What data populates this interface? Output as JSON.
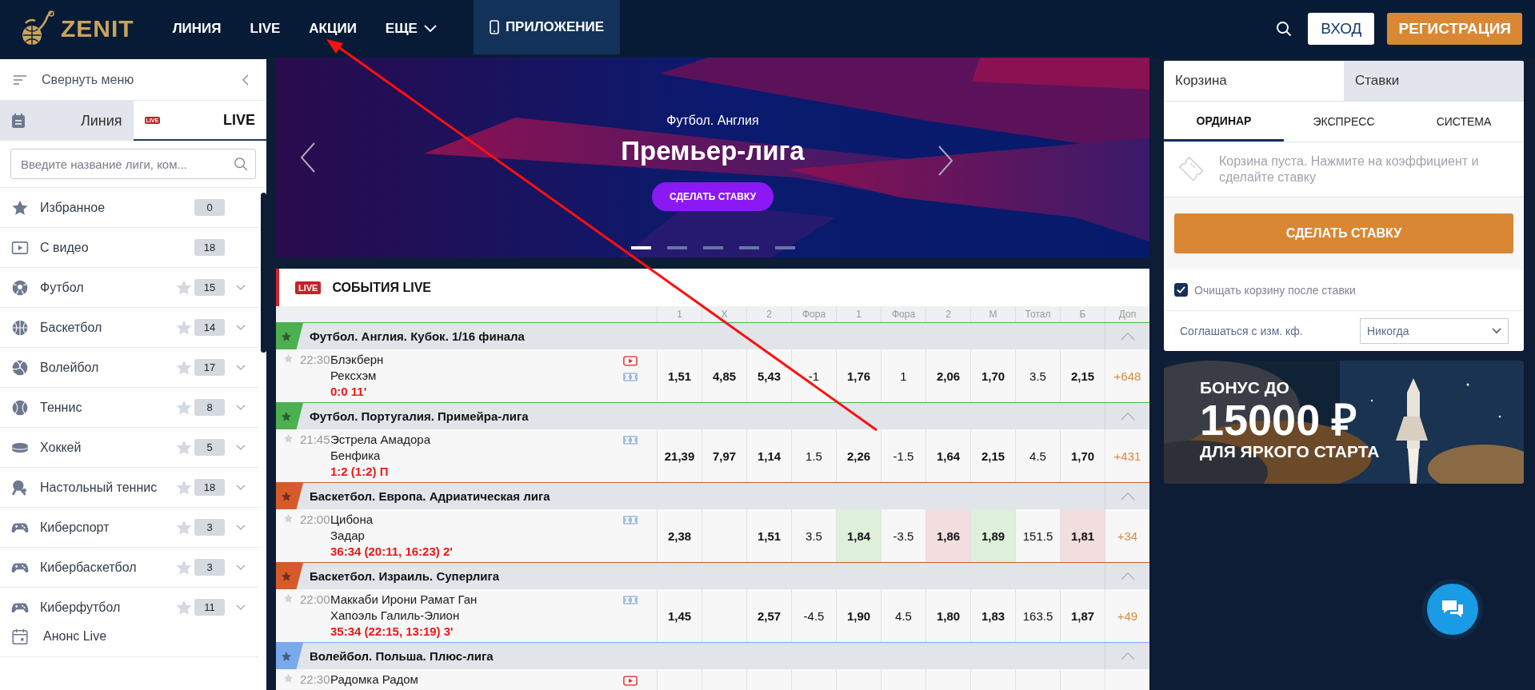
{
  "header": {
    "logo": "ZENIT",
    "nav": [
      {
        "label": "ЛИНИЯ",
        "kind": "link"
      },
      {
        "label": "LIVE",
        "kind": "link"
      },
      {
        "label": "АКЦИИ",
        "kind": "link"
      },
      {
        "label": "ЕЩЕ",
        "kind": "dropdown"
      },
      {
        "label": "ПРИЛОЖЕНИЕ",
        "kind": "app"
      }
    ],
    "login": "ВХОД",
    "register": "РЕГИСТРАЦИЯ"
  },
  "sidebar": {
    "collapse": "Свернуть меню",
    "tabs": [
      {
        "label": "Линия",
        "kind": "line",
        "selected": false
      },
      {
        "label": "LIVE",
        "kind": "live",
        "badge": "LIVE",
        "selected": true
      }
    ],
    "search": {
      "placeholder": "Введите название лиги, ком..."
    },
    "items": [
      {
        "label": "Избранное",
        "kind": "favorites",
        "count": "0"
      },
      {
        "label": "С видео",
        "kind": "video",
        "count": "18"
      },
      {
        "label": "Футбол",
        "kind": "football",
        "count": "15"
      },
      {
        "label": "Баскетбол",
        "kind": "basketball",
        "count": "14"
      },
      {
        "label": "Волейбол",
        "kind": "volleyball",
        "count": "17"
      },
      {
        "label": "Теннис",
        "kind": "tennis",
        "count": "8"
      },
      {
        "label": "Хоккей",
        "kind": "hockey",
        "count": "5"
      },
      {
        "label": "Настольный теннис",
        "kind": "table-tennis",
        "count": "18"
      },
      {
        "label": "Киберспорт",
        "kind": "esports",
        "count": "3"
      },
      {
        "label": "Кибербаскетбол",
        "kind": "esports",
        "count": "3"
      },
      {
        "label": "Киберфутбол",
        "kind": "esports",
        "count": "11"
      }
    ],
    "footer": "Анонс Live"
  },
  "banner": {
    "kicker": "Футбол. Англия",
    "title": "Премьер-лига",
    "button": "СДЕЛАТЬ СТАВКУ",
    "slides": [
      {
        "selected": true
      },
      {
        "selected": false
      },
      {
        "selected": false
      },
      {
        "selected": false
      },
      {
        "selected": false
      }
    ]
  },
  "events": {
    "badge": "LIVE",
    "title": "СОБЫТИЯ LIVE",
    "columns": [
      {
        "label": "1",
        "kind": "odd"
      },
      {
        "label": "X",
        "kind": "odd"
      },
      {
        "label": "2",
        "kind": "odd"
      },
      {
        "label": "Фора",
        "kind": "param"
      },
      {
        "label": "1",
        "kind": "odd"
      },
      {
        "label": "Фора",
        "kind": "param"
      },
      {
        "label": "2",
        "kind": "odd"
      },
      {
        "label": "М",
        "kind": "odd"
      },
      {
        "label": "Тотал",
        "kind": "param"
      },
      {
        "label": "Б",
        "kind": "odd"
      },
      {
        "label": "Доп",
        "kind": "more"
      }
    ],
    "groups": [
      {
        "title": "Футбол. Англия. Кубок. 1/16 финала",
        "color": "#4caf50",
        "events": [
          {
            "time": "22:30",
            "teams": [
              "Блэкберн",
              "Рексхэм"
            ],
            "score": "0:0 11'",
            "video": true,
            "stats": true,
            "odds": [
              {
                "value": "1,51",
                "kind": "plain"
              },
              {
                "value": "4,85",
                "kind": "plain"
              },
              {
                "value": "5,43",
                "kind": "plain"
              },
              {
                "value": "-1",
                "kind": "plain"
              },
              {
                "value": "1,76",
                "kind": "plain"
              },
              {
                "value": "1",
                "kind": "plain"
              },
              {
                "value": "2,06",
                "kind": "plain"
              },
              {
                "value": "1,70",
                "kind": "plain"
              },
              {
                "value": "3.5",
                "kind": "plain"
              },
              {
                "value": "2,15",
                "kind": "plain"
              },
              {
                "value": "+648",
                "kind": "plain"
              }
            ]
          }
        ]
      },
      {
        "title": "Футбол. Португалия. Примейра-лига",
        "color": "#4caf50",
        "events": [
          {
            "time": "21:45",
            "teams": [
              "Эстрела Амадора",
              "Бенфика"
            ],
            "score": "1:2 (1:2) П",
            "video": false,
            "stats": true,
            "odds": [
              {
                "value": "21,39",
                "kind": "plain"
              },
              {
                "value": "7,97",
                "kind": "plain"
              },
              {
                "value": "1,14",
                "kind": "plain"
              },
              {
                "value": "1.5",
                "kind": "plain"
              },
              {
                "value": "2,26",
                "kind": "plain"
              },
              {
                "value": "-1.5",
                "kind": "plain"
              },
              {
                "value": "1,64",
                "kind": "plain"
              },
              {
                "value": "2,15",
                "kind": "plain"
              },
              {
                "value": "4.5",
                "kind": "plain"
              },
              {
                "value": "1,70",
                "kind": "plain"
              },
              {
                "value": "+431",
                "kind": "plain"
              }
            ]
          }
        ]
      },
      {
        "title": "Баскетбол. Европа. Адриатическая лига",
        "color": "#d65a2b",
        "events": [
          {
            "time": "22:00",
            "teams": [
              "Цибона",
              "Задар"
            ],
            "score": "36:34 (20:11, 16:23) 2'",
            "video": false,
            "stats": true,
            "odds": [
              {
                "value": "2,38",
                "kind": "plain"
              },
              {
                "kind": "empty"
              },
              {
                "value": "1,51",
                "kind": "plain"
              },
              {
                "value": "3.5",
                "kind": "plain"
              },
              {
                "value": "1,84",
                "kind": "up"
              },
              {
                "value": "-3.5",
                "kind": "plain"
              },
              {
                "value": "1,86",
                "kind": "down"
              },
              {
                "value": "1,89",
                "kind": "up"
              },
              {
                "value": "151.5",
                "kind": "plain"
              },
              {
                "value": "1,81",
                "kind": "down"
              },
              {
                "value": "+34",
                "kind": "plain"
              }
            ]
          }
        ]
      },
      {
        "title": "Баскетбол. Израиль. Суперлига",
        "color": "#d65a2b",
        "events": [
          {
            "time": "22:00",
            "teams": [
              "Маккаби Ирони Рамат Ган",
              "Хапоэль Галиль-Элион"
            ],
            "score": "35:34 (22:15, 13:19) 3'",
            "video": false,
            "stats": true,
            "odds": [
              {
                "value": "1,45",
                "kind": "plain"
              },
              {
                "kind": "empty"
              },
              {
                "value": "2,57",
                "kind": "plain"
              },
              {
                "value": "-4.5",
                "kind": "plain"
              },
              {
                "value": "1,90",
                "kind": "plain"
              },
              {
                "value": "4.5",
                "kind": "plain"
              },
              {
                "value": "1,80",
                "kind": "plain"
              },
              {
                "value": "1,83",
                "kind": "plain"
              },
              {
                "value": "163.5",
                "kind": "plain"
              },
              {
                "value": "1,87",
                "kind": "plain"
              },
              {
                "value": "+49",
                "kind": "plain"
              }
            ]
          }
        ]
      },
      {
        "title": "Волейбол. Польша. Плюс-лига",
        "color": "#7aa9ee",
        "events": [
          {
            "time": "22:30",
            "teams": [
              "Радомка Радом"
            ],
            "video": true
          }
        ]
      }
    ]
  },
  "cart": {
    "tabs": [
      {
        "label": "Корзина",
        "selected": true
      },
      {
        "label": "Ставки",
        "selected": false
      }
    ],
    "modes": [
      {
        "label": "ОРДИНАР",
        "selected": true
      },
      {
        "label": "ЭКСПРЕСС",
        "selected": false
      },
      {
        "label": "СИСТЕМА",
        "selected": false
      }
    ],
    "empty": "Корзина пуста. Нажмите на коэффициент и сделайте ставку",
    "button": "СДЕЛАТЬ СТАВКУ",
    "clear_after": {
      "label": "Очищать корзину после ставки",
      "checked": true
    },
    "accept": {
      "label": "Соглашаться с изм. кф.",
      "value": "Никогда"
    }
  },
  "promo": {
    "lines": [
      "БОНУС ДО",
      "15000 ₽",
      "ДЛЯ ЯРКОГО СТАРТА"
    ]
  }
}
